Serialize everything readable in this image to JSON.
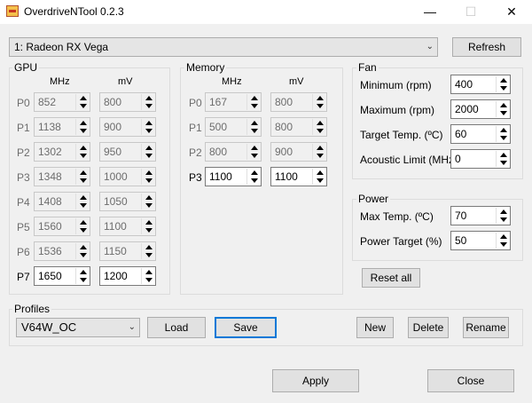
{
  "window": {
    "title": "OverdriveNTool 0.2.3"
  },
  "gpu_select": {
    "value": "1: Radeon RX Vega"
  },
  "refresh_label": "Refresh",
  "gpu": {
    "title": "GPU",
    "col_mhz": "MHz",
    "col_mv": "mV",
    "rows": [
      {
        "label": "P0",
        "mhz": "852",
        "mv": "800"
      },
      {
        "label": "P1",
        "mhz": "1138",
        "mv": "900"
      },
      {
        "label": "P2",
        "mhz": "1302",
        "mv": "950"
      },
      {
        "label": "P3",
        "mhz": "1348",
        "mv": "1000"
      },
      {
        "label": "P4",
        "mhz": "1408",
        "mv": "1050"
      },
      {
        "label": "P5",
        "mhz": "1560",
        "mv": "1100"
      },
      {
        "label": "P6",
        "mhz": "1536",
        "mv": "1150"
      },
      {
        "label": "P7",
        "mhz": "1650",
        "mv": "1200"
      }
    ]
  },
  "memory": {
    "title": "Memory",
    "col_mhz": "MHz",
    "col_mv": "mV",
    "rows": [
      {
        "label": "P0",
        "mhz": "167",
        "mv": "800"
      },
      {
        "label": "P1",
        "mhz": "500",
        "mv": "800"
      },
      {
        "label": "P2",
        "mhz": "800",
        "mv": "900"
      },
      {
        "label": "P3",
        "mhz": "1100",
        "mv": "1100"
      }
    ]
  },
  "fan": {
    "title": "Fan",
    "min_label": "Minimum (rpm)",
    "min_value": "400",
    "max_label": "Maximum (rpm)",
    "max_value": "2000",
    "target_label": "Target Temp. (ºC)",
    "target_value": "60",
    "acoustic_label": "Acoustic Limit (MHz)",
    "acoustic_value": "0"
  },
  "power": {
    "title": "Power",
    "maxtemp_label": "Max Temp. (ºC)",
    "maxtemp_value": "70",
    "target_label": "Power Target (%)",
    "target_value": "50"
  },
  "reset_label": "Reset all",
  "profiles": {
    "title": "Profiles",
    "selected": "V64W_OC",
    "load": "Load",
    "save": "Save",
    "new": "New",
    "delete": "Delete",
    "rename": "Rename"
  },
  "apply_label": "Apply",
  "close_label": "Close"
}
